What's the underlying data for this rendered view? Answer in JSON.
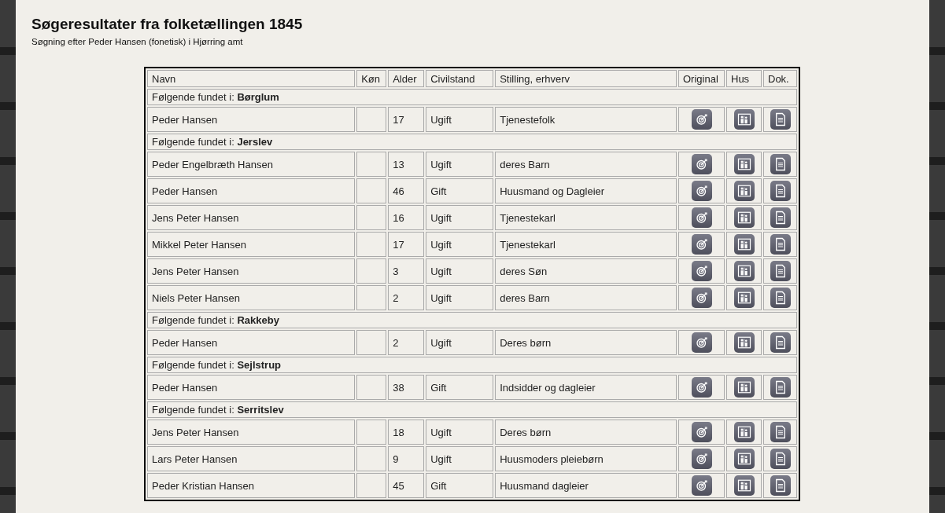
{
  "title": "Søgeresultater fra folketællingen 1845",
  "subtitle": "Søgning efter Peder Hansen (fonetisk) i Hjørring amt",
  "table": {
    "columns": [
      "Navn",
      "Køn",
      "Alder",
      "Civilstand",
      "Stilling, erhverv",
      "Original",
      "Hus",
      "Dok."
    ],
    "groups": [
      {
        "label": "Følgende fundet i: **Børglum**",
        "rows": [
          {
            "name": "Peder Hansen",
            "age": "17",
            "status": "Ugift",
            "occupation": "Tjenestefolk"
          }
        ]
      },
      {
        "label": "Følgende fundet i: **Jerslev**",
        "rows": [
          {
            "name": "Peder Engelbræth Hansen",
            "age": "13",
            "status": "Ugift",
            "occupation": "deres Barn"
          },
          {
            "name": "Peder Hansen",
            "age": "46",
            "status": "Gift",
            "occupation": "Huusmand og Dagleier"
          },
          {
            "name": "Jens Peter Hansen",
            "age": "16",
            "status": "Ugift",
            "occupation": "Tjenestekarl"
          },
          {
            "name": "Mikkel Peter Hansen",
            "age": "17",
            "status": "Ugift",
            "occupation": "Tjenestekarl"
          },
          {
            "name": "Jens Peter Hansen",
            "age": "3",
            "status": "Ugift",
            "occupation": "deres Søn"
          },
          {
            "name": "Niels Peter Hansen",
            "age": "2",
            "status": "Ugift",
            "occupation": "deres Barn"
          }
        ]
      },
      {
        "label": "Følgende fundet i: **Rakkeby**",
        "rows": [
          {
            "name": "Peder Hansen",
            "age": "2",
            "status": "Ugift",
            "occupation": "Deres børn"
          }
        ]
      },
      {
        "label": "Følgende fundet i: **Sejlstrup**",
        "rows": [
          {
            "name": "Peder Hansen",
            "age": "38",
            "status": "Gift",
            "occupation": "Indsidder og dagleier"
          }
        ]
      },
      {
        "label": "Følgende fundet i: **Serritslev**",
        "rows": [
          {
            "name": "Jens Peter Hansen",
            "age": "18",
            "status": "Ugift",
            "occupation": "Deres børn"
          },
          {
            "name": "Lars Peter Hansen",
            "age": "9",
            "status": "Ugift",
            "occupation": "Huusmoders pleiebørn"
          },
          {
            "name": "Peder Kristian Hansen",
            "age": "45",
            "status": "Gift",
            "occupation": "Huusmand dagleier"
          }
        ]
      }
    ]
  }
}
